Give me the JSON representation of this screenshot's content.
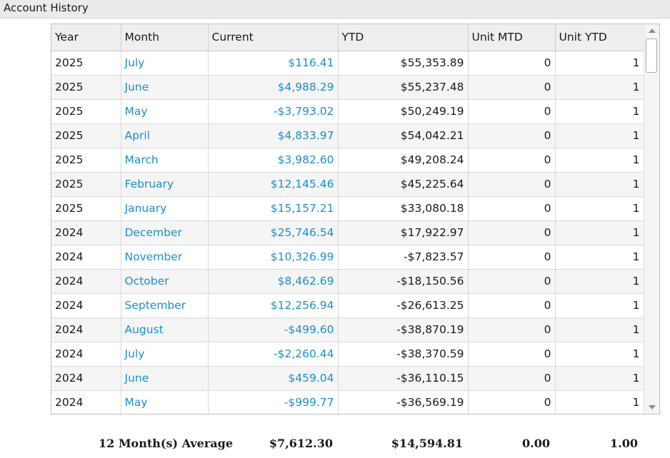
{
  "window": {
    "title": "Account History"
  },
  "table": {
    "headers": {
      "year": "Year",
      "month": "Month",
      "current": "Current",
      "ytd": "YTD",
      "unit_mtd": "Unit MTD",
      "unit_ytd": "Unit YTD"
    },
    "rows": [
      {
        "year": "2025",
        "month": "July",
        "current": "$116.41",
        "ytd": "$55,353.89",
        "unit_mtd": "0",
        "unit_ytd": "1"
      },
      {
        "year": "2025",
        "month": "June",
        "current": "$4,988.29",
        "ytd": "$55,237.48",
        "unit_mtd": "0",
        "unit_ytd": "1"
      },
      {
        "year": "2025",
        "month": "May",
        "current": "-$3,793.02",
        "ytd": "$50,249.19",
        "unit_mtd": "0",
        "unit_ytd": "1"
      },
      {
        "year": "2025",
        "month": "April",
        "current": "$4,833.97",
        "ytd": "$54,042.21",
        "unit_mtd": "0",
        "unit_ytd": "1"
      },
      {
        "year": "2025",
        "month": "March",
        "current": "$3,982.60",
        "ytd": "$49,208.24",
        "unit_mtd": "0",
        "unit_ytd": "1"
      },
      {
        "year": "2025",
        "month": "February",
        "current": "$12,145.46",
        "ytd": "$45,225.64",
        "unit_mtd": "0",
        "unit_ytd": "1"
      },
      {
        "year": "2025",
        "month": "January",
        "current": "$15,157.21",
        "ytd": "$33,080.18",
        "unit_mtd": "0",
        "unit_ytd": "1"
      },
      {
        "year": "2024",
        "month": "December",
        "current": "$25,746.54",
        "ytd": "$17,922.97",
        "unit_mtd": "0",
        "unit_ytd": "1"
      },
      {
        "year": "2024",
        "month": "November",
        "current": "$10,326.99",
        "ytd": "-$7,823.57",
        "unit_mtd": "0",
        "unit_ytd": "1"
      },
      {
        "year": "2024",
        "month": "October",
        "current": "$8,462.69",
        "ytd": "-$18,150.56",
        "unit_mtd": "0",
        "unit_ytd": "1"
      },
      {
        "year": "2024",
        "month": "September",
        "current": "$12,256.94",
        "ytd": "-$26,613.25",
        "unit_mtd": "0",
        "unit_ytd": "1"
      },
      {
        "year": "2024",
        "month": "August",
        "current": "-$499.60",
        "ytd": "-$38,870.19",
        "unit_mtd": "0",
        "unit_ytd": "1"
      },
      {
        "year": "2024",
        "month": "July",
        "current": "-$2,260.44",
        "ytd": "-$38,370.59",
        "unit_mtd": "0",
        "unit_ytd": "1"
      },
      {
        "year": "2024",
        "month": "June",
        "current": "$459.04",
        "ytd": "-$36,110.15",
        "unit_mtd": "0",
        "unit_ytd": "1"
      },
      {
        "year": "2024",
        "month": "May",
        "current": "-$999.77",
        "ytd": "-$36,569.19",
        "unit_mtd": "0",
        "unit_ytd": "1"
      }
    ]
  },
  "summary": {
    "label": "12 Month(s) Average",
    "current": "$7,612.30",
    "ytd": "$14,594.81",
    "unit_mtd": "0.00",
    "unit_ytd": "1.00"
  },
  "scrollbar": {
    "up_icon": "triangle-up-icon",
    "down_icon": "triangle-down-icon"
  },
  "colors": {
    "link": "#1b8fce",
    "header_bg": "#efefef",
    "title_bg": "#ebebeb",
    "alt_row_bg": "#f5f5f5"
  }
}
